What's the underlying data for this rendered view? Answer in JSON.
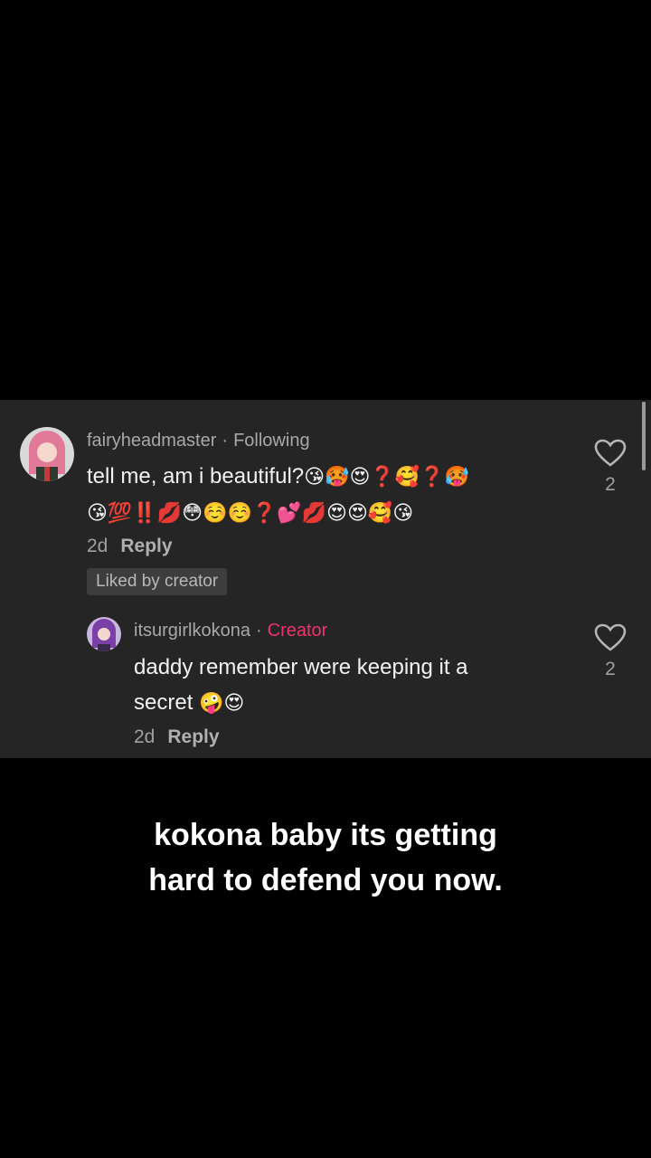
{
  "comments": [
    {
      "username": "fairyheadmaster",
      "tag": "Following",
      "text": "tell me, am i beautiful?",
      "emoji_line1": "😘🥵😍❓🥰❓🥵",
      "emoji_line2": "😘💯‼️💋😳☺️☺️❓💕💋😍😍🥰😘",
      "time": "2d",
      "reply_label": "Reply",
      "badge": "Liked by creator",
      "like_count": "2"
    },
    {
      "username": "itsurgirlkokona",
      "tag": "Creator",
      "text_line1": "daddy remember were keeping it a",
      "text_line2": "secret",
      "emojis": "🤪😍",
      "time": "2d",
      "reply_label": "Reply",
      "like_count": "2"
    }
  ],
  "caption": {
    "line1": "kokona baby its getting",
    "line2": "hard to defend you now."
  },
  "colors": {
    "panel": "#252525",
    "creator_tag": "#f0336d"
  }
}
